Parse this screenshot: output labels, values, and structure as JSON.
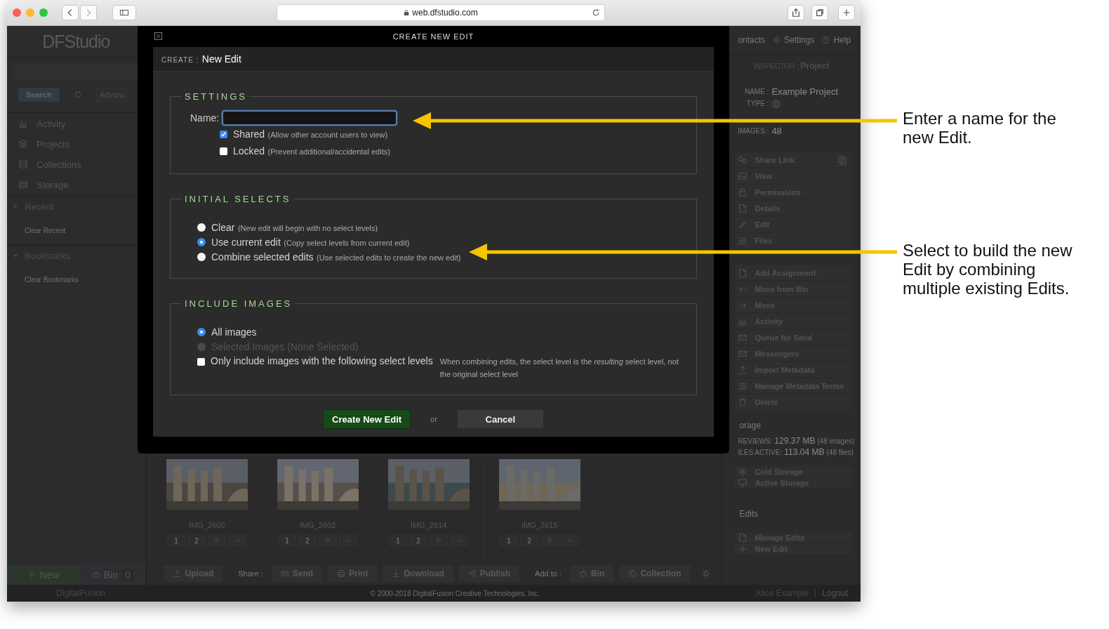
{
  "browser": {
    "url": "web.dfstudio.com"
  },
  "app": {
    "logo": "DFStudio",
    "sidebar": {
      "search_button": "Search",
      "advanced": "Advanc",
      "nav": [
        {
          "label": "Activity"
        },
        {
          "label": "Projects"
        },
        {
          "label": "Collections"
        },
        {
          "label": "Storage"
        }
      ],
      "sections": [
        {
          "title": "Recent",
          "expanded": true,
          "action": "Clear Recent"
        },
        {
          "title": "Bookmarks",
          "expanded": true,
          "action": "Clear Bookmarks"
        }
      ],
      "new_button": "New",
      "bin": {
        "label": "Bin",
        "count": "0"
      }
    },
    "top_links": [
      {
        "label": "ontacts"
      },
      {
        "label": "Settings"
      },
      {
        "label": "Help"
      }
    ],
    "images": [
      {
        "name": "IMG_2600",
        "buttons": [
          "1",
          "2"
        ]
      },
      {
        "name": "IMG_2602",
        "buttons": [
          "1",
          "2"
        ]
      },
      {
        "name": "IMG_2614",
        "buttons": [
          "1",
          "2"
        ]
      },
      {
        "name": "IMG_2615",
        "buttons": [
          "1",
          "2"
        ]
      }
    ],
    "toolbar": [
      {
        "kind": "button",
        "label": "Upload"
      },
      {
        "kind": "label",
        "label": "Share :"
      },
      {
        "kind": "button",
        "label": "Send"
      },
      {
        "kind": "button",
        "label": "Print"
      },
      {
        "kind": "button",
        "label": "Download"
      },
      {
        "kind": "button",
        "label": "Publish"
      },
      {
        "kind": "label",
        "label": "Add to :"
      },
      {
        "kind": "button",
        "label": "Bin"
      },
      {
        "kind": "button",
        "label": "Collection"
      }
    ],
    "inspector": {
      "label": "INSPECTOR :",
      "title": "Project",
      "fields": [
        {
          "label": "NAME :",
          "value": "Example Project"
        },
        {
          "label": "TYPE :",
          "kind": "icon"
        },
        {
          "label": "IMAGES :",
          "value": "48"
        }
      ],
      "actions": [
        {
          "label": "Share Link"
        },
        {
          "label": "View"
        },
        {
          "label": "Permissions"
        },
        {
          "label": "Details"
        },
        {
          "label": "Edit"
        },
        {
          "label": "Files"
        },
        {
          "label": "Add Assignment"
        },
        {
          "label": "Move from Bin"
        },
        {
          "label": "Move"
        },
        {
          "label": "Activity"
        },
        {
          "label": "Queue for Send"
        },
        {
          "label": "Messengers"
        },
        {
          "label": "Import Metadata"
        },
        {
          "label": "Manage Metadata Terms"
        },
        {
          "label": "Delete"
        }
      ],
      "storage": {
        "title": "orage",
        "rows": [
          {
            "label": "REVIEWS:",
            "value": "129.37 MB",
            "note": "(48 images)"
          },
          {
            "label": "ILES ACTIVE:",
            "value": "113.04 MB",
            "note": "(48 files)"
          }
        ],
        "actions": [
          {
            "label": "Cold Storage"
          },
          {
            "label": "Active Storage"
          }
        ]
      },
      "edits": {
        "title": "Edits",
        "actions": [
          {
            "label": "Manage Edits"
          },
          {
            "label": "New Edit"
          }
        ]
      }
    },
    "footer": {
      "brand": "DigitalFusion",
      "copyright": "© 2000-2018 DigitalFusion Creative Technologies, Inc.",
      "user": "Alice Example",
      "logout": "Logout"
    }
  },
  "modal": {
    "title": "CREATE NEW EDIT",
    "header_label": "CREATE :",
    "header_value": "New Edit",
    "settings": {
      "legend": "SETTINGS",
      "name_label": "Name:",
      "options": [
        {
          "label": "Shared",
          "note": "(Allow other account users to view)",
          "checked": true
        },
        {
          "label": "Locked",
          "note": "(Prevent additional/accidental edits)",
          "checked": false
        }
      ]
    },
    "initial_selects": {
      "legend": "INITIAL SELECTS",
      "options": [
        {
          "label": "Clear",
          "note": "(New edit will begin with no select levels)",
          "selected": false
        },
        {
          "label": "Use current edit",
          "note": "(Copy select levels from current edit)",
          "selected": true
        },
        {
          "label": "Combine selected edits",
          "note": "(Use selected edits to create the new edit)",
          "selected": false
        }
      ]
    },
    "include_images": {
      "legend": "INCLUDE IMAGES",
      "options": [
        {
          "label": "All images",
          "selected": true,
          "disabled": false
        },
        {
          "label": "Selected Images (None Selected)",
          "selected": false,
          "disabled": true
        }
      ],
      "filter": {
        "label": "Only include images with the following select levels",
        "checked": false,
        "note": "When combining edits, the select level is the *resulting* select level, not the original select level"
      }
    },
    "buttons": {
      "create": "Create New Edit",
      "or": "or",
      "cancel": "Cancel"
    }
  },
  "annotations": [
    {
      "text": "Enter a name for the new Edit."
    },
    {
      "text": "Select to build the new Edit by combining multiple existing Edits."
    }
  ]
}
